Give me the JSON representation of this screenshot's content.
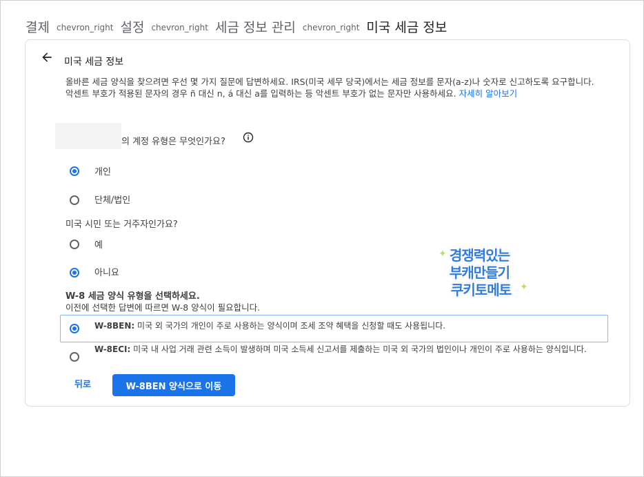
{
  "breadcrumb": {
    "items": [
      "결제",
      "설정",
      "세금 정보 관리",
      "미국 세금 정보"
    ],
    "separator": "chevron_right"
  },
  "page": {
    "title": "미국 세금 정보",
    "intro": "올바른 세금 양식을 찾으려면 우선 몇 가지 질문에 답변하세요. IRS(미국 세무 당국)에서는 세금 정보를 문자(a-z)나 숫자로 신고하도록 요구합니다. 악센트 부호가 적용된 문자의 경우 ñ 대신 n, á 대신 a를 입력하는 등 악센트 부호가 없는 문자만 사용하세요.",
    "learn_more": "자세히 알아보기"
  },
  "q1": {
    "label": "의 계정 유형은 무엇인가요?",
    "options": [
      {
        "label": "개인",
        "checked": true
      },
      {
        "label": "단체/법인",
        "checked": false
      }
    ]
  },
  "q2": {
    "label": "미국 시민 또는 거주자인가요?",
    "options": [
      {
        "label": "예",
        "checked": false
      },
      {
        "label": "아니요",
        "checked": true
      }
    ]
  },
  "w8": {
    "heading": "W-8 세금 양식 유형을 선택하세요.",
    "subheading": "이전에 선택한 답변에 따르면 W-8 양식이 필요합니다.",
    "options": [
      {
        "code": "W-8BEN:",
        "desc": "미국 외 국가의 개인이 주로 사용하는 양식이며 조세 조약 혜택을 신청할 때도 사용됩니다.",
        "checked": true
      },
      {
        "code": "W-8ECI:",
        "desc": "미국 내 사업 거래 관련 소득이 발생하며 미국 소득세 신고서를 제출하는 미국 외 국가의 법인이나 개인이 주로 사용하는 양식입니다.",
        "checked": false
      }
    ]
  },
  "buttons": {
    "back": "뒤로",
    "primary": "W-8BEN 양식으로 이동"
  },
  "watermark": {
    "lines": [
      "경쟁력있는",
      "부캐만들기",
      "쿠키토메토"
    ]
  },
  "colors": {
    "accent": "#1a73e8",
    "text": "#3c4043",
    "border": "#dadce0"
  }
}
